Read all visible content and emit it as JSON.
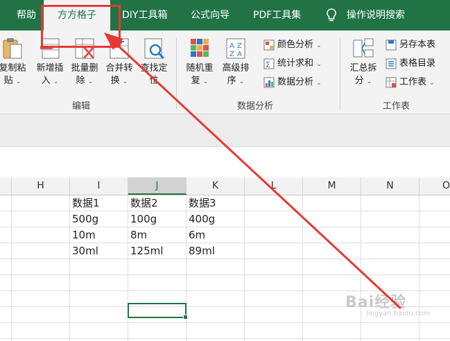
{
  "tabs": [
    {
      "label": "帮助",
      "active": false
    },
    {
      "label": "方方格子",
      "active": true
    },
    {
      "label": "DIY工具箱",
      "active": false
    },
    {
      "label": "公式向导",
      "active": false
    },
    {
      "label": "PDF工具集",
      "active": false
    }
  ],
  "search_label": "操作说明搜索",
  "ribbon": {
    "edit_group": {
      "label": "编辑",
      "buttons": [
        {
          "line1": "复制粘",
          "line2": "贴"
        },
        {
          "line1": "新增插",
          "line2": "入"
        },
        {
          "line1": "批量删",
          "line2": "除"
        },
        {
          "line1": "合并转",
          "line2": "换"
        },
        {
          "line1": "查找定",
          "line2": "位"
        }
      ]
    },
    "analysis_group": {
      "label": "数据分析",
      "buttons": [
        {
          "line1": "随机重",
          "line2": "复"
        },
        {
          "line1": "高级排",
          "line2": "序"
        }
      ],
      "small": [
        {
          "label": "颜色分析"
        },
        {
          "label": "统计求和"
        },
        {
          "label": "数据分析"
        }
      ]
    },
    "sheet_group": {
      "label": "工作表",
      "buttons": [
        {
          "line1": "汇总拆",
          "line2": "分"
        }
      ],
      "small": [
        {
          "label": "另存本表"
        },
        {
          "label": "表格目录"
        },
        {
          "label": "工作表"
        }
      ]
    }
  },
  "columns": [
    "H",
    "I",
    "J",
    "K",
    "L",
    "M",
    "N",
    "O"
  ],
  "cells": {
    "r1": [
      "数据1",
      "数据2",
      "数据3"
    ],
    "r2": [
      "500g",
      "100g",
      "400g"
    ],
    "r3": [
      "10m",
      "8m",
      "6m"
    ],
    "r4": [
      "30ml",
      "125ml",
      "89ml"
    ]
  },
  "watermark": {
    "main": "Bai经验",
    "sub": "jingyan.baidu.com"
  },
  "colors": {
    "accent": "#217346",
    "annotation": "#e53935"
  }
}
